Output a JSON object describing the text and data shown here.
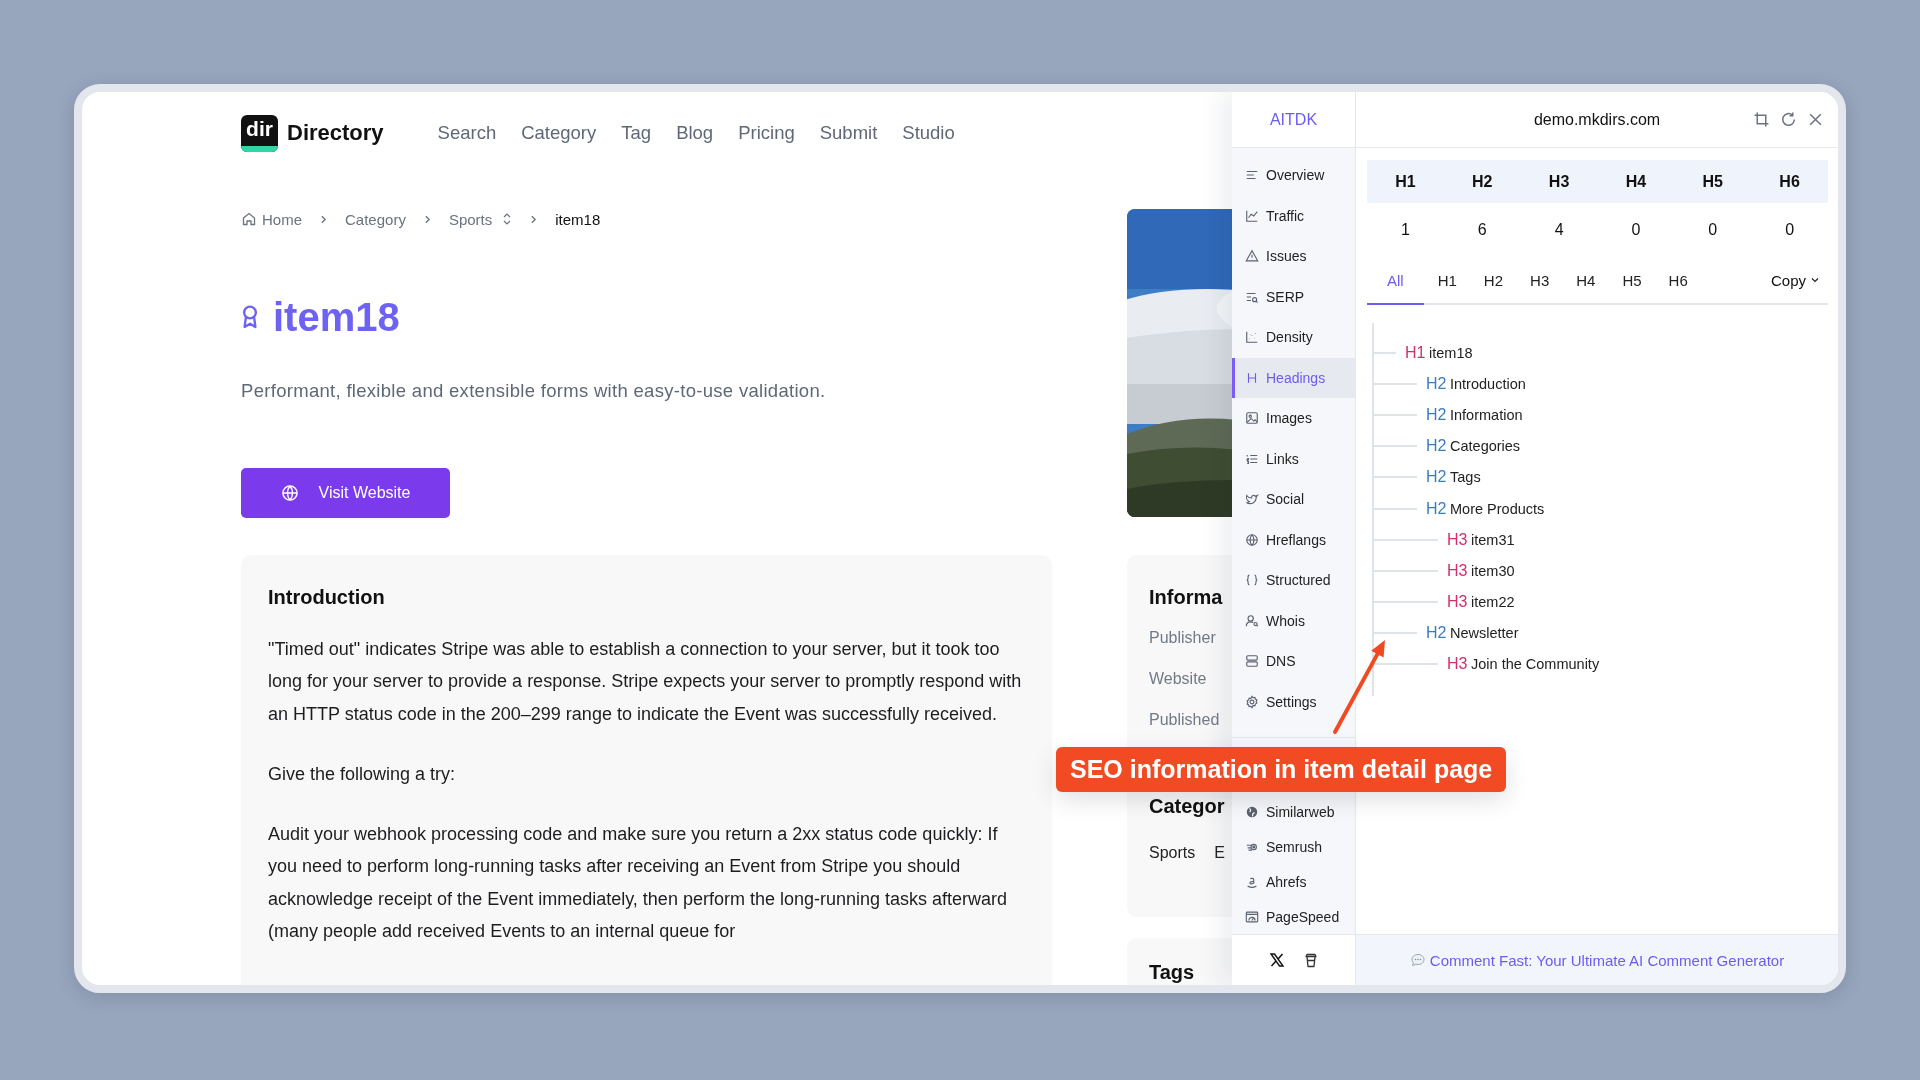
{
  "site": {
    "logo_text": "dir",
    "brand": "Directory",
    "nav": [
      "Search",
      "Category",
      "Tag",
      "Blog",
      "Pricing",
      "Submit",
      "Studio"
    ],
    "breadcrumb": [
      "Home",
      "Category",
      "Sports",
      "item18"
    ],
    "title": "item18",
    "description": "Performant, flexible and extensible forms with easy-to-use validation.",
    "visit_button": "Visit Website",
    "introduction": {
      "heading": "Introduction",
      "paragraphs": [
        "\"Timed out\" indicates Stripe was able to establish a connection to your server, but it took too long for your server to provide a response. Stripe expects your server to promptly respond with an HTTP status code in the 200–299 range to indicate the Event was successfully received.",
        "Give the following a try:",
        "Audit your webhook processing code and make sure you return a 2xx status code quickly: If you need to perform long-running tasks after receiving an Event from Stripe you should acknowledge receipt of the Event immediately, then perform the long-running tasks afterward (many people add received Events to an internal queue for"
      ]
    },
    "information": {
      "heading": "Informa",
      "labels": [
        "Publisher",
        "Website",
        "Published"
      ],
      "categories_heading": "Categor",
      "categories": [
        "Sports",
        "E"
      ]
    },
    "tags_heading": "Tags"
  },
  "panel": {
    "brand": "AITDK",
    "domain": "demo.mkdirs.com",
    "menu": [
      {
        "label": "Overview",
        "selected": false
      },
      {
        "label": "Traffic",
        "selected": false
      },
      {
        "label": "Issues",
        "selected": false
      },
      {
        "label": "SERP",
        "selected": false
      },
      {
        "label": "Density",
        "selected": false
      },
      {
        "label": "Headings",
        "selected": true
      },
      {
        "label": "Images",
        "selected": false
      },
      {
        "label": "Links",
        "selected": false
      },
      {
        "label": "Social",
        "selected": false
      },
      {
        "label": "Hreflangs",
        "selected": false
      },
      {
        "label": "Structured",
        "selected": false
      },
      {
        "label": "Whois",
        "selected": false
      },
      {
        "label": "DNS",
        "selected": false
      },
      {
        "label": "Settings",
        "selected": false
      }
    ],
    "tools": [
      {
        "label": "Similarweb",
        "selected": false
      },
      {
        "label": "Semrush",
        "selected": false
      },
      {
        "label": "Ahrefs",
        "selected": false
      },
      {
        "label": "PageSpeed",
        "selected": false
      }
    ],
    "heading_counts": [
      {
        "label": "H1",
        "count": "1"
      },
      {
        "label": "H2",
        "count": "6"
      },
      {
        "label": "H3",
        "count": "4"
      },
      {
        "label": "H4",
        "count": "0"
      },
      {
        "label": "H5",
        "count": "0"
      },
      {
        "label": "H6",
        "count": "0"
      }
    ],
    "tabs": [
      {
        "label": "All",
        "selected": true
      },
      {
        "label": "H1",
        "selected": false
      },
      {
        "label": "H2",
        "selected": false
      },
      {
        "label": "H3",
        "selected": false
      },
      {
        "label": "H4",
        "selected": false
      },
      {
        "label": "H5",
        "selected": false
      },
      {
        "label": "H6",
        "selected": false
      }
    ],
    "copy_button": "Copy",
    "tree": [
      {
        "tag": "H1",
        "text": "item18",
        "color": "#d0306f",
        "children": [
          {
            "tag": "H2",
            "text": "Introduction",
            "color": "#3a7cc2"
          },
          {
            "tag": "H2",
            "text": "Information",
            "color": "#3a7cc2"
          },
          {
            "tag": "H2",
            "text": "Categories",
            "color": "#3a7cc2"
          },
          {
            "tag": "H2",
            "text": "Tags",
            "color": "#3a7cc2"
          },
          {
            "tag": "H2",
            "text": "More Products",
            "color": "#3a7cc2",
            "children": [
              {
                "tag": "H3",
                "text": "item31",
                "color": "#d0306f"
              },
              {
                "tag": "H3",
                "text": "item30",
                "color": "#d0306f"
              },
              {
                "tag": "H3",
                "text": "item22",
                "color": "#d0306f"
              }
            ]
          },
          {
            "tag": "H2",
            "text": "Newsletter",
            "color": "#3a7cc2",
            "children": [
              {
                "tag": "H3",
                "text": "Join the Community",
                "color": "#d0306f"
              }
            ]
          }
        ]
      }
    ],
    "footer_link": "Comment Fast: Your Ultimate AI Comment Generator"
  },
  "annotation": {
    "text": "SEO information in item detail page"
  }
}
